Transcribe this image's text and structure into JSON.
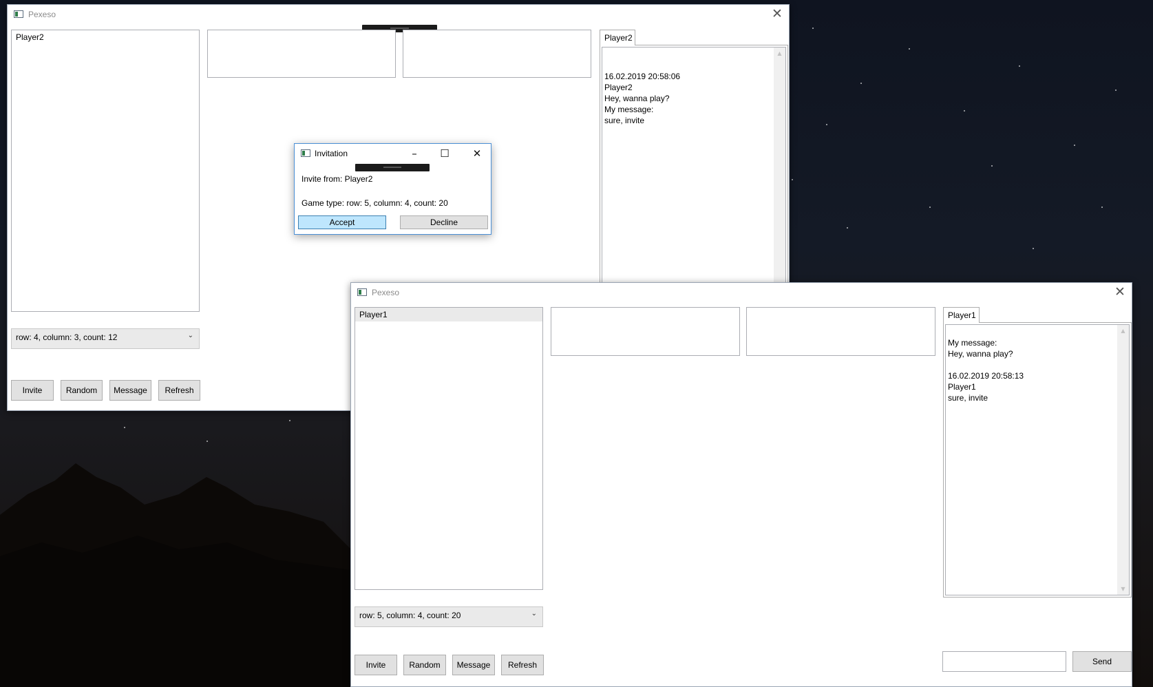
{
  "colors": {
    "accent_button": "#bee6fd",
    "button_face": "#e1e1e1",
    "selection": "#eaeaea",
    "dialog_border": "#4a8fd6"
  },
  "window1": {
    "title": "Pexeso",
    "close_icon": "close-icon",
    "players": [
      "Player2"
    ],
    "game_type_selected": "row: 4, column: 3, count: 12",
    "buttons": {
      "invite": "Invite",
      "random": "Random",
      "message": "Message",
      "refresh": "Refresh"
    },
    "chat_tab": "Player2",
    "chat_text": "16.02.2019 20:58:06\nPlayer2\nHey, wanna play?\nMy message:\nsure, invite"
  },
  "dialog": {
    "title": "Invitation",
    "invite_from": "Invite from: Player2",
    "game_type": "Game type: row: 5, column: 4, count: 20",
    "accept": "Accept",
    "decline": "Decline"
  },
  "window2": {
    "title": "Pexeso",
    "close_icon": "close-icon",
    "players": [
      "Player1"
    ],
    "game_type_selected": "row: 5, column: 4, count: 20",
    "buttons": {
      "invite": "Invite",
      "random": "Random",
      "message": "Message",
      "refresh": "Refresh",
      "send": "Send"
    },
    "chat_tab": "Player1",
    "chat_text": "My message:\nHey, wanna play?\n\n16.02.2019 20:58:13\nPlayer1\nsure, invite",
    "message_input": ""
  }
}
